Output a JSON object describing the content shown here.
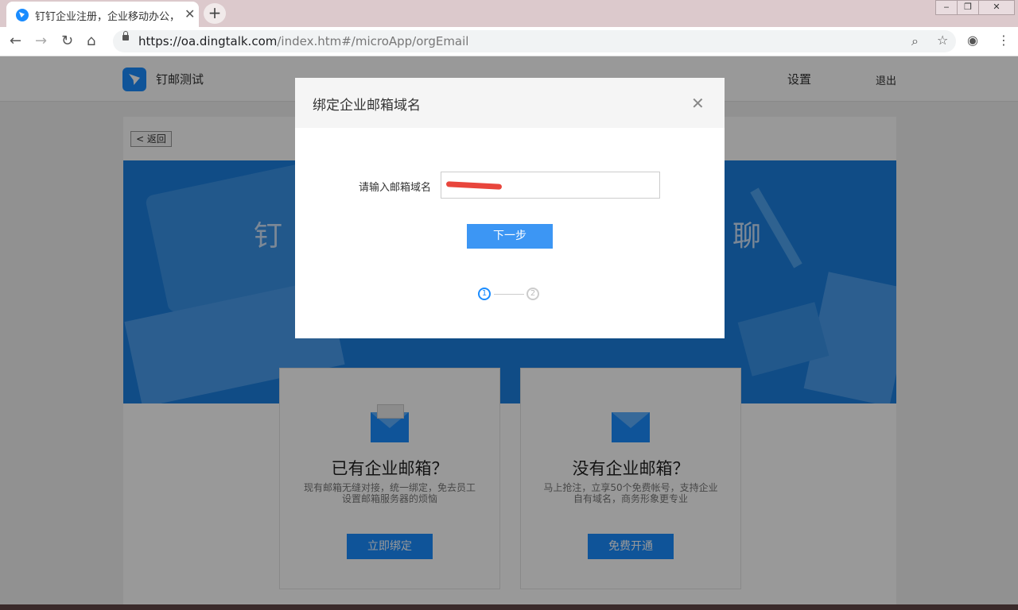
{
  "browser": {
    "tab_title": "钉钉企业注册，企业移动办公，全",
    "url_host": "https://oa.dingtalk.com",
    "url_path": "/index.htm#/microApp/orgEmail"
  },
  "header": {
    "org_name": "钉邮测试",
    "nav": [
      "设置",
      "退出"
    ]
  },
  "page": {
    "back_label": "< 返回",
    "banner_left": "钉",
    "banner_right": "聊"
  },
  "cards": [
    {
      "title": "已有企业邮箱？",
      "desc": "现有邮箱无缝对接，统一绑定，免去员工设置邮箱服务器的烦恼",
      "button": "立即绑定"
    },
    {
      "title": "没有企业邮箱？",
      "desc": "马上抢注，立享50个免费帐号，支持企业自有域名，商务形象更专业",
      "button": "免费开通"
    }
  ],
  "modal": {
    "title": "绑定企业邮箱域名",
    "field_label": "请输入邮箱域名",
    "next_label": "下一步",
    "steps": [
      "1",
      "2"
    ]
  },
  "colors": {
    "accent": "#1a8cff",
    "banner": "#1b7fe0"
  }
}
